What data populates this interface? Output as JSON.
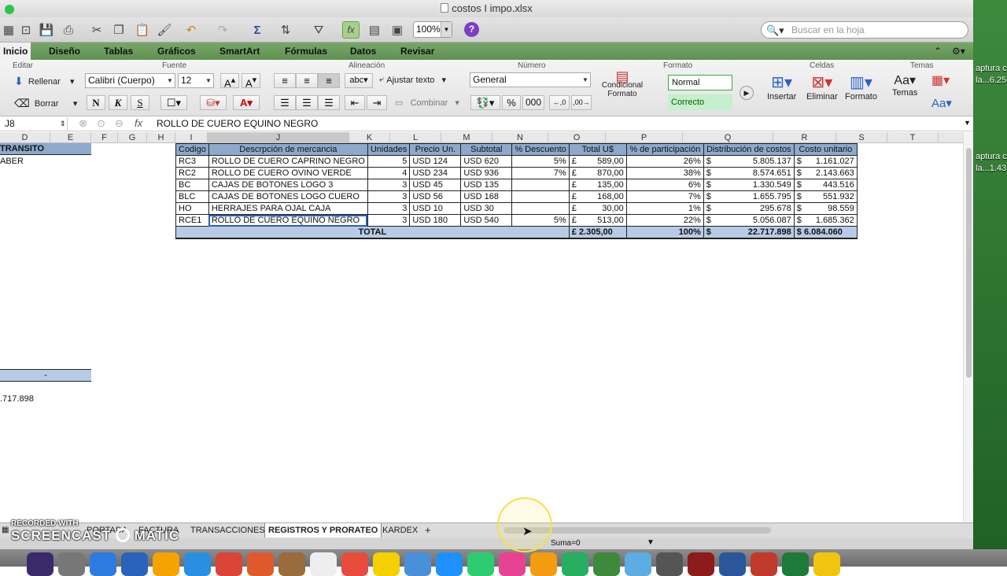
{
  "window": {
    "title": "costos I impo.xlsx",
    "zoom": "100%",
    "search_placeholder": "Buscar en la hoja"
  },
  "ribbon_tabs": [
    "Inicio",
    "Diseño",
    "Tablas",
    "Gráficos",
    "SmartArt",
    "Fórmulas",
    "Datos",
    "Revisar"
  ],
  "groups": {
    "editar": "Editar",
    "fuente": "Fuente",
    "alineacion": "Alineación",
    "numero": "Número",
    "formato": "Formato",
    "celdas": "Celdas",
    "temas": "Temas"
  },
  "ribbon": {
    "rellenar": "Rellenar",
    "borrar": "Borrar",
    "font": "Calibri (Cuerpo)",
    "size": "12",
    "bold": "N",
    "italic": "K",
    "underline": "S",
    "wrap": "Ajustar texto",
    "merge": "Combinar",
    "number_format": "General",
    "percent": "%",
    "thousands": "000",
    "cond1": "Condicional",
    "cond2": "Formato",
    "style_normal": "Normal",
    "style_correcto": "Correcto",
    "insertar": "Insertar",
    "eliminar": "Eliminar",
    "formato": "Formato",
    "temas": "Temas",
    "abc": "abc"
  },
  "formula_bar": {
    "cell": "J8",
    "fx": "fx",
    "content": "ROLLO DE CUERO EQUINO NEGRO"
  },
  "columns": [
    "D",
    "E",
    "F",
    "G",
    "H",
    "I",
    "J",
    "K",
    "L",
    "M",
    "N",
    "O",
    "P",
    "Q",
    "R",
    "S",
    "T"
  ],
  "table": {
    "headers": [
      "Codigo",
      "Descrpción de mercancia",
      "Unidades",
      "Precio Un.",
      "Subtotal",
      "% Descuento",
      "Total U$",
      "% de participación",
      "Distribución de costos",
      "Costo unitario"
    ],
    "rows": [
      {
        "code": "RC3",
        "desc": "ROLLO DE CUERO CAPRINO NEGRO",
        "units": "5",
        "price": "USD 124",
        "subtotal": "USD 620",
        "disc": "5%",
        "total_sym": "£",
        "total": "589,00",
        "part": "26%",
        "dist_sym": "$",
        "dist": "5.805.137",
        "unit_sym": "$",
        "unit": "1.161.027"
      },
      {
        "code": "RC2",
        "desc": "ROLLO DE CUERO OVINO VERDE",
        "units": "4",
        "price": "USD 234",
        "subtotal": "USD 936",
        "disc": "7%",
        "total_sym": "£",
        "total": "870,00",
        "part": "38%",
        "dist_sym": "$",
        "dist": "8.574.651",
        "unit_sym": "$",
        "unit": "2.143.663"
      },
      {
        "code": "BC",
        "desc": "CAJAS DE BOTONES LOGO 3",
        "units": "3",
        "price": "USD 45",
        "subtotal": "USD 135",
        "disc": "",
        "total_sym": "£",
        "total": "135,00",
        "part": "6%",
        "dist_sym": "$",
        "dist": "1.330.549",
        "unit_sym": "$",
        "unit": "443.516"
      },
      {
        "code": "BLC",
        "desc": "CAJAS DE BOTONES LOGO CUERO",
        "units": "3",
        "price": "USD 56",
        "subtotal": "USD 168",
        "disc": "",
        "total_sym": "£",
        "total": "168,00",
        "part": "7%",
        "dist_sym": "$",
        "dist": "1.655.795",
        "unit_sym": "$",
        "unit": "551.932"
      },
      {
        "code": "HO",
        "desc": "HERRAJES PARA OJAL CAJA",
        "units": "3",
        "price": "USD 10",
        "subtotal": "USD 30",
        "disc": "",
        "total_sym": "£",
        "total": "30,00",
        "part": "1%",
        "dist_sym": "$",
        "dist": "295.678",
        "unit_sym": "$",
        "unit": "98.559"
      },
      {
        "code": "RCE1",
        "desc": "ROLLO DE CUERO EQUINO NEGRO",
        "units": "3",
        "price": "USD 180",
        "subtotal": "USD 540",
        "disc": "5%",
        "total_sym": "£",
        "total": "513,00",
        "part": "22%",
        "dist_sym": "$",
        "dist": "5.056.087",
        "unit_sym": "$",
        "unit": "1.685.362"
      }
    ],
    "total": {
      "label": "TOTAL",
      "total": "£ 2.305,00",
      "part": "100%",
      "dist_sym": "$",
      "dist": "22.717.898",
      "unit": "$ 6.084.060"
    }
  },
  "left_cells": {
    "d_header": "TRANSITO",
    "d_row": "ABER",
    "dash": "-",
    "sum": ".717.898"
  },
  "sheets": [
    "PORTADA",
    "FACTURA",
    "TRANSACCIONES",
    "REGISTROS Y PRORATEO",
    "KARDEX",
    "+"
  ],
  "status": {
    "suma": "Suma=0"
  },
  "watermark": {
    "line1": "RECORDED WITH",
    "line2": "SCREENCAST",
    "line3": "MATIC"
  },
  "desktop": {
    "t1": "aptura c",
    "t2": "la...6.25",
    "t3": "aptura c",
    "t4": "la...1.43"
  }
}
